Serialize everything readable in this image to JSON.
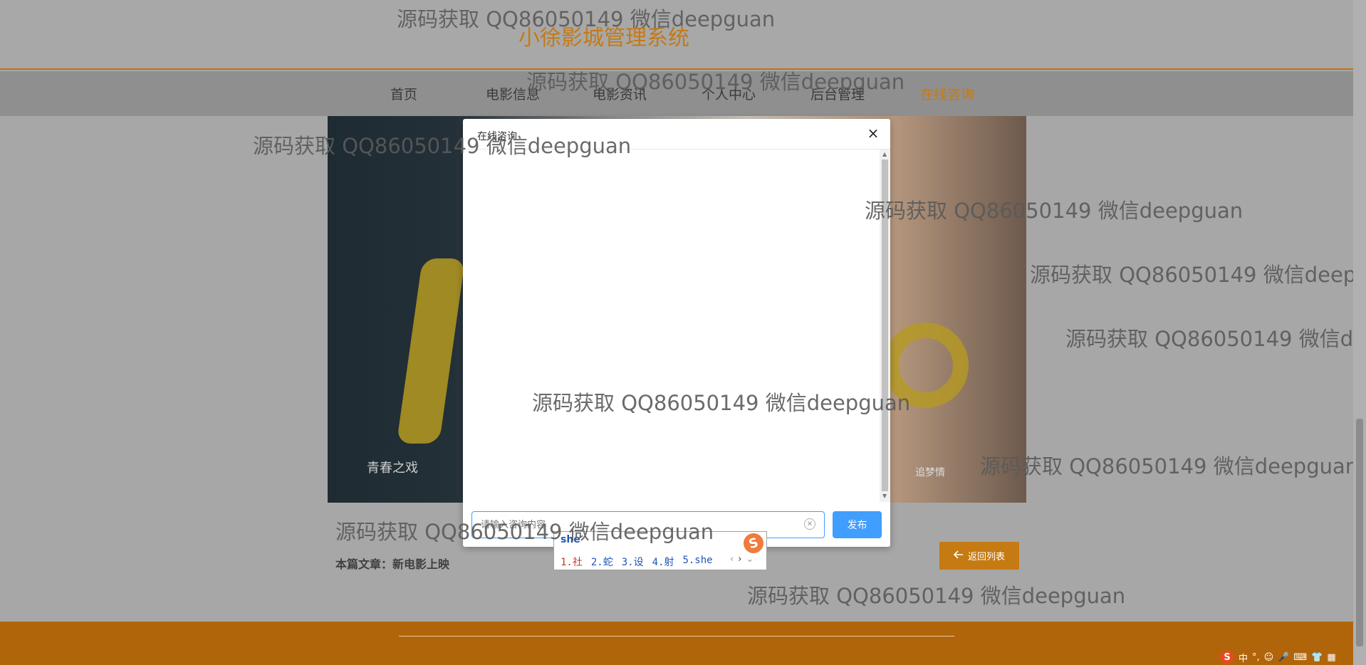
{
  "site": {
    "title": "小徐影城管理系统"
  },
  "nav": {
    "items": [
      "首页",
      "电影信息",
      "电影资讯",
      "个人中心",
      "后台管理",
      "在线咨询"
    ],
    "active_index": 5
  },
  "article": {
    "meta": "本篇文章：新电影上映",
    "back_label": "返回列表"
  },
  "modal": {
    "title": "在线咨询",
    "close_glyph": "×",
    "input_placeholder": "请输入咨询内容",
    "publish_label": "发布"
  },
  "ime": {
    "composition": "she",
    "candidates": [
      "1.社",
      "2.蛇",
      "3.设",
      "4.射",
      "5.she"
    ],
    "logo": "S"
  },
  "tray": {
    "logo": "S",
    "items": [
      "中",
      "°,",
      "☺",
      "🎤",
      "⌨",
      "👕",
      "▦"
    ]
  },
  "watermark": {
    "text": "源码获取 QQ86050149 微信deepguan"
  },
  "colors": {
    "accent": "#c47a17",
    "primary": "#409eff",
    "footer": "#b1650a"
  }
}
